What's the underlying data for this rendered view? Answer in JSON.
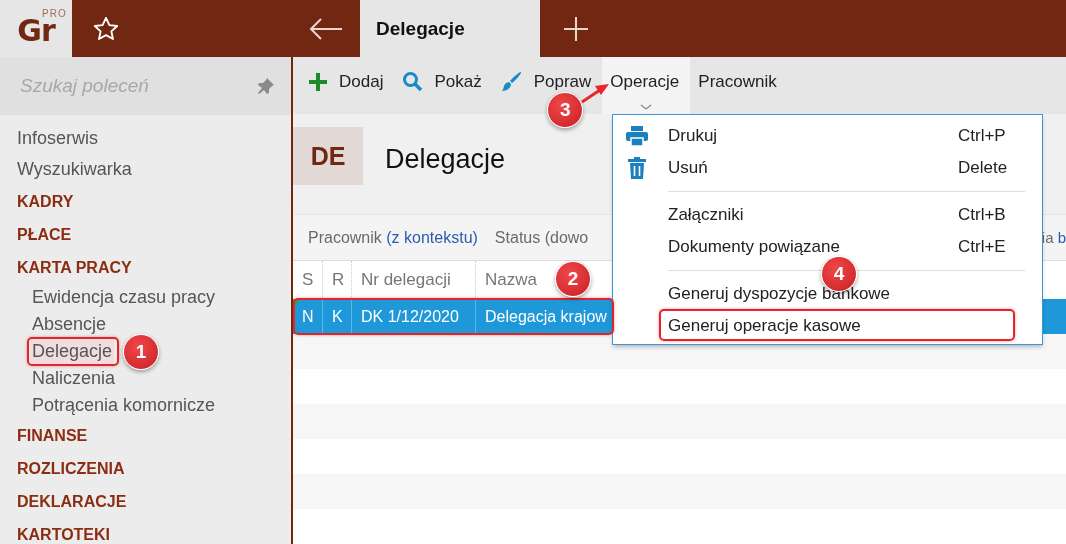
{
  "app": {
    "logo": "Gr",
    "edition": "PRO"
  },
  "tabs": [
    {
      "label": "Delegacje",
      "selected": true
    }
  ],
  "sidebar": {
    "search": {
      "placeholder": "Szukaj poleceń"
    },
    "items": [
      {
        "kind": "link",
        "label": "Infoserwis"
      },
      {
        "kind": "link",
        "label": "Wyszukiwarka"
      },
      {
        "kind": "section",
        "label": "KADRY"
      },
      {
        "kind": "section",
        "label": "PŁACE"
      },
      {
        "kind": "section",
        "label": "KARTA PRACY",
        "children": [
          {
            "label": "Ewidencja czasu pracy",
            "selected": false
          },
          {
            "label": "Absencje",
            "selected": false
          },
          {
            "label": "Delegacje",
            "selected": true,
            "step": "1"
          },
          {
            "label": "Naliczenia",
            "selected": false
          },
          {
            "label": "Potrącenia komornicze",
            "selected": false
          }
        ]
      },
      {
        "kind": "section",
        "label": "FINANSE"
      },
      {
        "kind": "section",
        "label": "ROZLICZENIA"
      },
      {
        "kind": "section",
        "label": "DEKLARACJE"
      },
      {
        "kind": "section",
        "label": "KARTOTEKI"
      }
    ]
  },
  "toolbar": [
    {
      "kind": "add",
      "label": "Dodaj",
      "open": false
    },
    {
      "kind": "view",
      "label": "Pokaż",
      "open": false
    },
    {
      "kind": "edit",
      "label": "Popraw",
      "open": false
    },
    {
      "kind": "menu",
      "label": "Operacje",
      "open": true,
      "step": "3"
    },
    {
      "kind": "plain",
      "label": "Pracownik",
      "open": false
    }
  ],
  "header": {
    "code": "DE",
    "title": "Delegacje"
  },
  "filters": [
    {
      "label": "Pracownik",
      "value": "(z kontekstu)"
    },
    {
      "label": "Status (dowo"
    },
    {
      "label": "ia",
      "value": "b"
    }
  ],
  "table": {
    "columns": [
      "S",
      "R",
      "Nr delegacji",
      "Nazwa"
    ],
    "rows": [
      {
        "cells": [
          "N",
          "K",
          "DK 1/12/2020",
          "Delegacja krajow"
        ],
        "selected": true,
        "step": "2"
      }
    ]
  },
  "menu": {
    "groups": [
      [
        {
          "kind": "print",
          "label": "Drukuj",
          "shortcut": "Ctrl+P"
        },
        {
          "kind": "delete",
          "label": "Usuń",
          "shortcut": "Delete"
        }
      ],
      [
        {
          "label": "Załączniki",
          "shortcut": "Ctrl+B"
        },
        {
          "label": "Dokumenty powiązane",
          "shortcut": "Ctrl+E"
        }
      ],
      [
        {
          "label": "Generuj dyspozycje bankowe"
        },
        {
          "label": "Generuj operacje kasowe",
          "step": "4"
        }
      ]
    ]
  }
}
